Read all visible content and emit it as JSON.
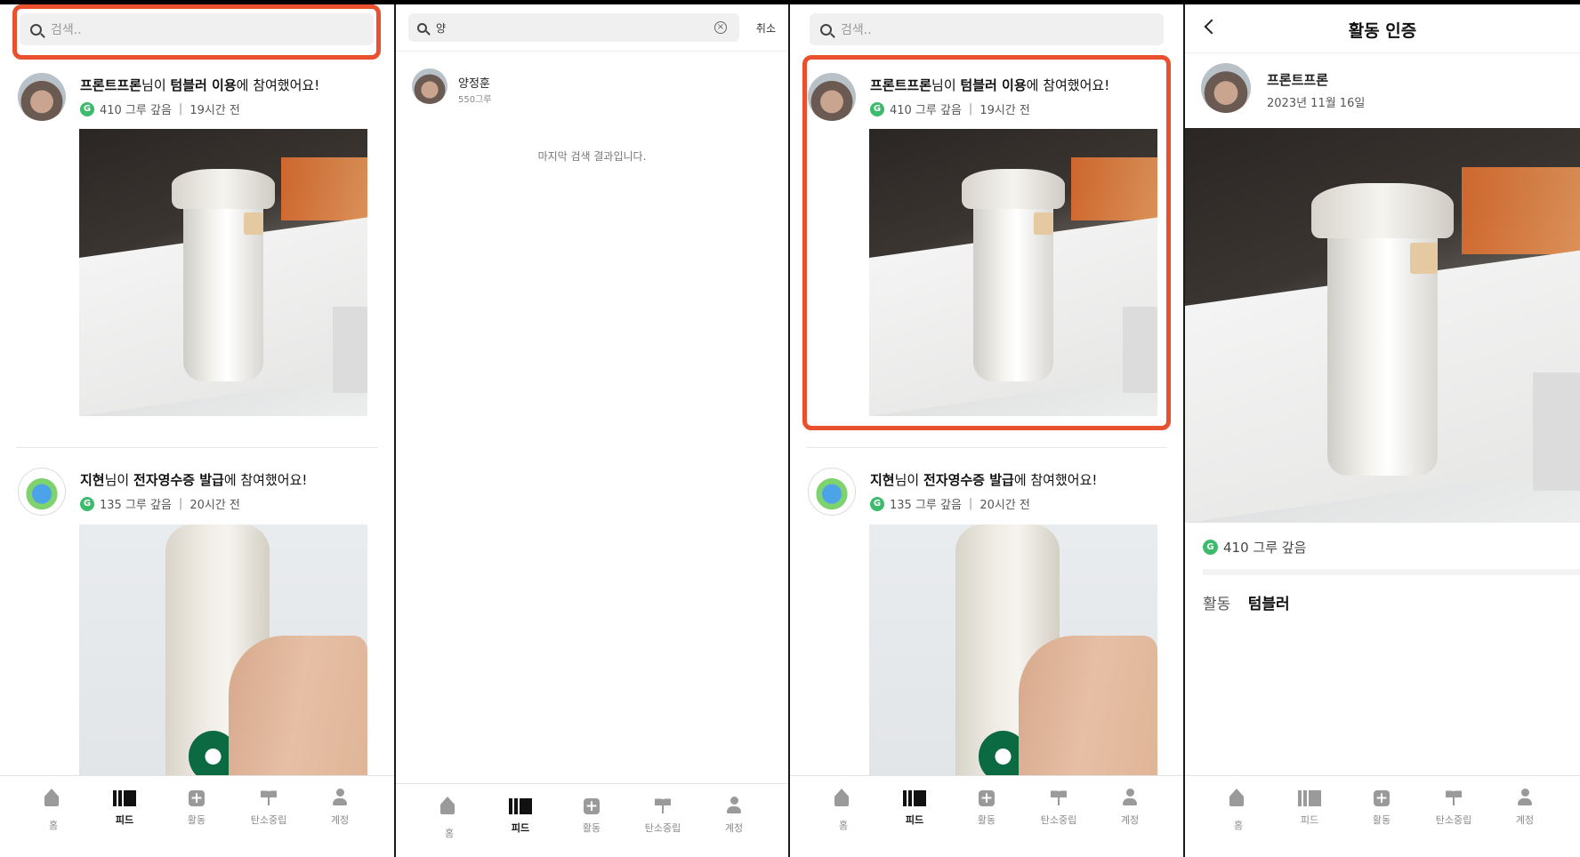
{
  "search": {
    "placeholder": "검색.."
  },
  "posts": [
    {
      "user": "프론트프론",
      "suffix": "님이 ",
      "activity": "텀블러 이용",
      "tail": "에 참여했어요!",
      "badge": "G",
      "points": "410 그루 갚음",
      "time": "19시간 전"
    },
    {
      "user": "지현",
      "suffix": "님이 ",
      "activity": "전자영수증 발급",
      "tail": "에 참여했어요!",
      "badge": "G",
      "points": "135 그루 갚음",
      "time": "20시간 전"
    }
  ],
  "nav": [
    {
      "label": "홈",
      "icon": "home-icon"
    },
    {
      "label": "피드",
      "icon": "feed-icon"
    },
    {
      "label": "활동",
      "icon": "plus-icon"
    },
    {
      "label": "탄소중립",
      "icon": "sprout-icon"
    },
    {
      "label": "계정",
      "icon": "user-icon"
    }
  ],
  "search_result": {
    "query": "양",
    "clear_icon": "clear-icon",
    "cancel_label": "취소",
    "result_name": "양정훈",
    "result_sub": "550그루",
    "end_message": "마지막 검색 결과입니다."
  },
  "detail": {
    "title": "활동 인증",
    "user": "프론트프론",
    "date": "2023년 11월 16일",
    "badge": "G",
    "points": "410 그루 갚음",
    "activity_key": "활동",
    "activity_value": "텀블러"
  },
  "colors": {
    "highlight": "#e8502e",
    "badge_green": "#3dbb6c"
  }
}
